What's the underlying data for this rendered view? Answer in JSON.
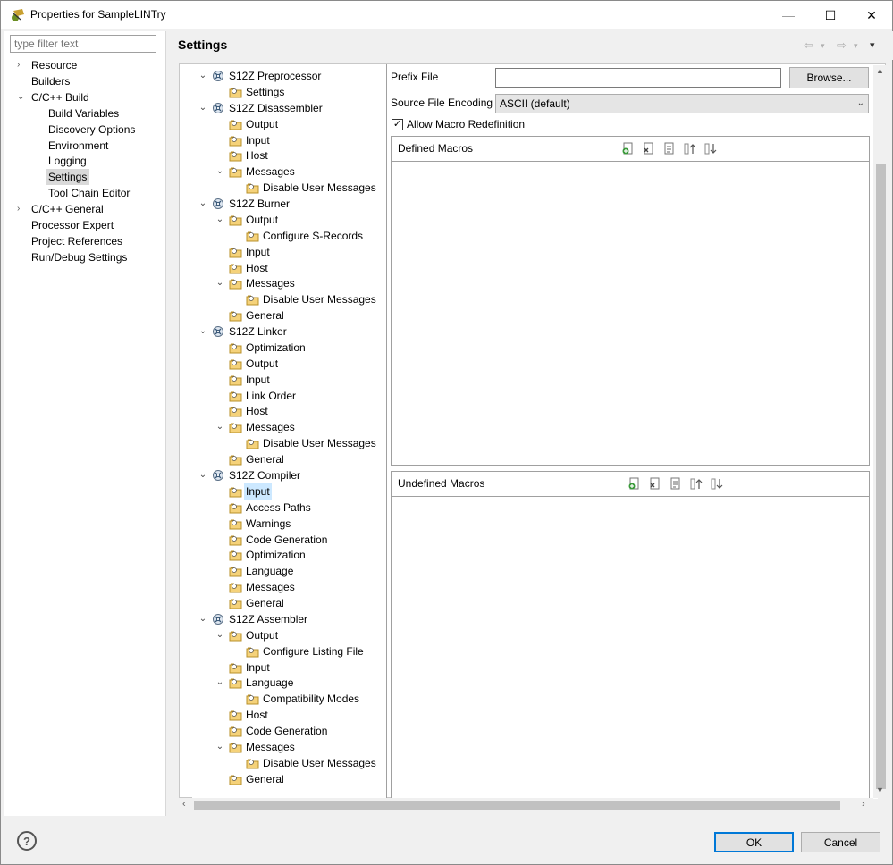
{
  "window": {
    "title": "Properties for SampleLINTry",
    "minimize_symbol": "—",
    "maximize_symbol": "☐",
    "close_symbol": "✕"
  },
  "sidebar": {
    "filter_placeholder": "type filter text",
    "items": [
      {
        "label": "Resource",
        "arrow": "›"
      },
      {
        "label": "Builders",
        "arrow": ""
      },
      {
        "label": "C/C++ Build",
        "arrow": "⌄"
      },
      {
        "label": "Build Variables",
        "arrow": ""
      },
      {
        "label": "Discovery Options",
        "arrow": ""
      },
      {
        "label": "Environment",
        "arrow": ""
      },
      {
        "label": "Logging",
        "arrow": ""
      },
      {
        "label": "Settings",
        "arrow": ""
      },
      {
        "label": "Tool Chain Editor",
        "arrow": ""
      },
      {
        "label": "C/C++ General",
        "arrow": "›"
      },
      {
        "label": "Processor Expert",
        "arrow": ""
      },
      {
        "label": "Project References",
        "arrow": ""
      },
      {
        "label": "Run/Debug Settings",
        "arrow": ""
      }
    ]
  },
  "header": {
    "title": "Settings",
    "back_icon": "⇦",
    "forward_icon": "⇨",
    "menu_icon": "▾"
  },
  "tree": {
    "expand_glyph": "⌄",
    "items": [
      {
        "label": "S12Z Preprocessor"
      },
      {
        "label": "Settings"
      },
      {
        "label": "S12Z Disassembler"
      },
      {
        "label": "Output"
      },
      {
        "label": "Input"
      },
      {
        "label": "Host"
      },
      {
        "label": "Messages"
      },
      {
        "label": "Disable User Messages"
      },
      {
        "label": "S12Z Burner"
      },
      {
        "label": "Output"
      },
      {
        "label": "Configure S-Records"
      },
      {
        "label": "Input"
      },
      {
        "label": "Host"
      },
      {
        "label": "Messages"
      },
      {
        "label": "Disable User Messages"
      },
      {
        "label": "General"
      },
      {
        "label": "S12Z Linker"
      },
      {
        "label": "Optimization"
      },
      {
        "label": "Output"
      },
      {
        "label": "Input"
      },
      {
        "label": "Link Order"
      },
      {
        "label": "Host"
      },
      {
        "label": "Messages"
      },
      {
        "label": "Disable User Messages"
      },
      {
        "label": "General"
      },
      {
        "label": "S12Z Compiler"
      },
      {
        "label": "Input"
      },
      {
        "label": "Access Paths"
      },
      {
        "label": "Warnings"
      },
      {
        "label": "Code Generation"
      },
      {
        "label": "Optimization"
      },
      {
        "label": "Language"
      },
      {
        "label": "Messages"
      },
      {
        "label": "General"
      },
      {
        "label": "S12Z Assembler"
      },
      {
        "label": "Output"
      },
      {
        "label": "Configure Listing File"
      },
      {
        "label": "Input"
      },
      {
        "label": "Language"
      },
      {
        "label": "Compatibility Modes"
      },
      {
        "label": "Host"
      },
      {
        "label": "Code Generation"
      },
      {
        "label": "Messages"
      },
      {
        "label": "Disable User Messages"
      },
      {
        "label": "General"
      }
    ]
  },
  "properties": {
    "prefix_file_label": "Prefix File",
    "prefix_file_value": "",
    "browse_label": "Browse...",
    "encoding_label": "Source File Encoding",
    "encoding_value": "ASCII (default)",
    "allow_macro_label": "Allow Macro Redefinition",
    "allow_macro_checked": "✓",
    "defined_macros_title": "Defined Macros",
    "undefined_macros_title": "Undefined Macros"
  },
  "buttons": {
    "help": "?",
    "ok": "OK",
    "cancel": "Cancel"
  },
  "scroll": {
    "up": "▲",
    "down": "▼",
    "left": "‹",
    "right": "›"
  }
}
